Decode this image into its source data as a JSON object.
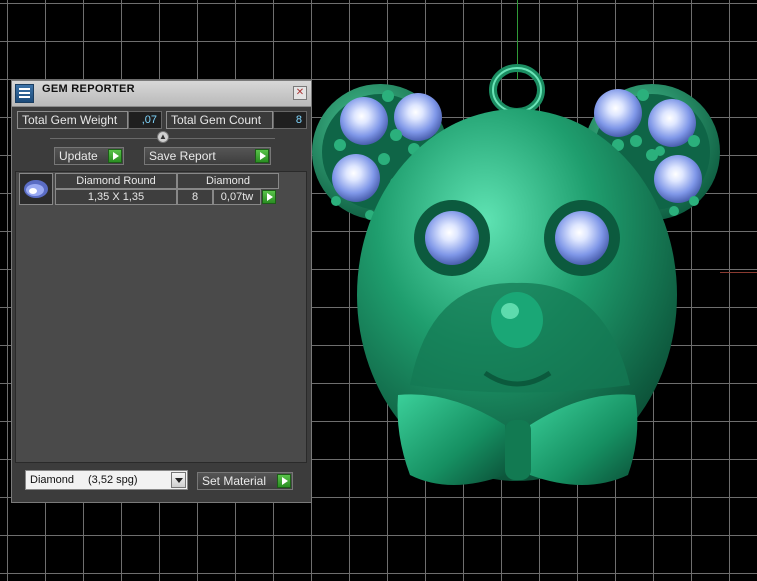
{
  "panel": {
    "title": "GEM REPORTER",
    "close_symbol": "✕",
    "total_gem_weight_label": "Total Gem Weight",
    "total_gem_weight_value": ",07",
    "total_gem_count_label": "Total Gem Count",
    "total_gem_count_value": "8",
    "update_label": "Update",
    "save_report_label": "Save Report",
    "gem_rows": [
      {
        "name": "Diamond Round",
        "type": "Diamond",
        "size": "1,35 X 1,35",
        "count": "8",
        "weight": "0,07tw"
      }
    ],
    "material_value": "Diamond",
    "material_spg": "(3,52 spg)",
    "set_material_label": "Set Material"
  },
  "icons": {
    "title": "gem-reporter-icon",
    "collapse": "collapse-up-icon",
    "row_action": "play-arrow-icon",
    "dropdown": "chevron-down-icon"
  },
  "colors": {
    "model_green": "#1f9e6e",
    "gem_blue": "#9fb8ff",
    "action_green": "#3aaa2e",
    "value_text": "#7fd7ff"
  }
}
